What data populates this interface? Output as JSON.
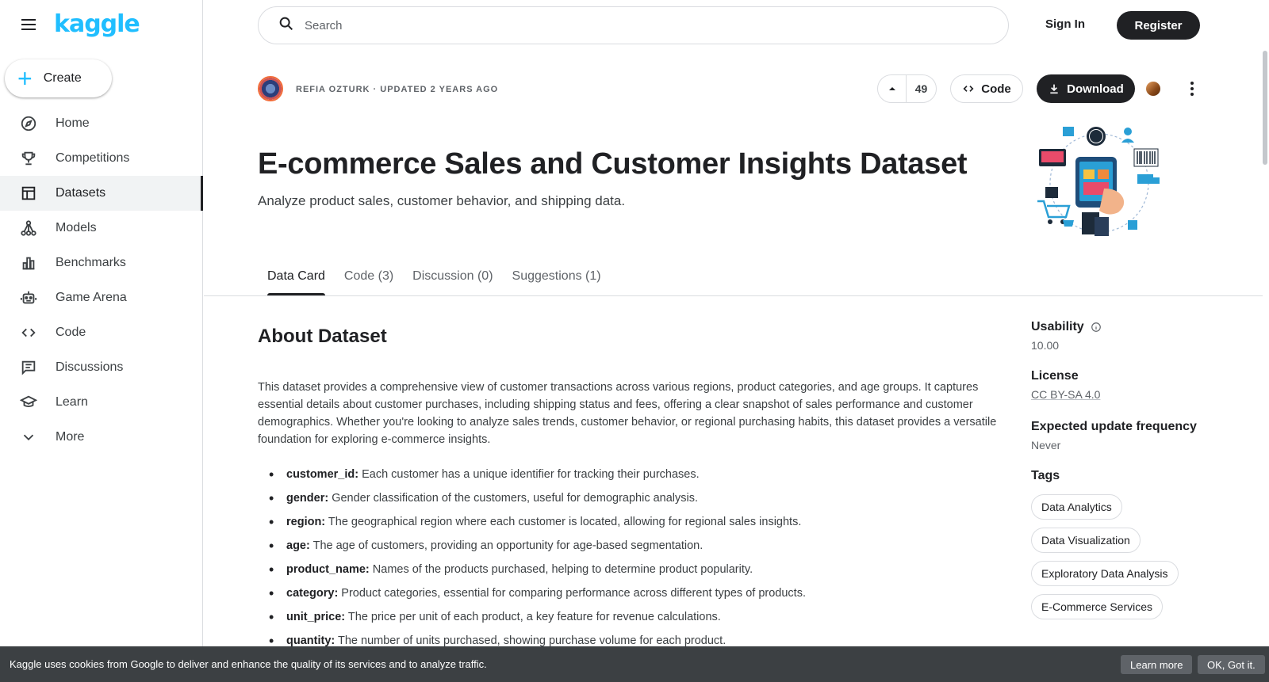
{
  "brand": {
    "logo_text": "kaggle"
  },
  "sidebar": {
    "create_label": "Create",
    "items": [
      {
        "label": "Home",
        "icon": "compass-icon"
      },
      {
        "label": "Competitions",
        "icon": "trophy-icon"
      },
      {
        "label": "Datasets",
        "icon": "table-icon",
        "active": true
      },
      {
        "label": "Models",
        "icon": "models-icon"
      },
      {
        "label": "Benchmarks",
        "icon": "bar-chart-icon"
      },
      {
        "label": "Game Arena",
        "icon": "robot-icon"
      },
      {
        "label": "Code",
        "icon": "code-icon"
      },
      {
        "label": "Discussions",
        "icon": "discussion-icon"
      },
      {
        "label": "Learn",
        "icon": "graduation-cap-icon"
      },
      {
        "label": "More",
        "icon": "chevron-down-icon"
      }
    ]
  },
  "topbar": {
    "search_placeholder": "Search",
    "sign_in_label": "Sign In",
    "register_label": "Register"
  },
  "dataset": {
    "author_line": "Refia Ozturk · Updated 2 years ago",
    "vote_count": "49",
    "code_label": "Code",
    "download_label": "Download",
    "title": "E-commerce Sales and Customer Insights Dataset",
    "subtitle": "Analyze product sales, customer behavior, and shipping data."
  },
  "tabs": [
    {
      "label": "Data Card",
      "active": true
    },
    {
      "label": "Code (3)"
    },
    {
      "label": "Discussion (0)"
    },
    {
      "label": "Suggestions (1)"
    }
  ],
  "about": {
    "heading": "About Dataset",
    "description": "This dataset provides a comprehensive view of customer transactions across various regions, product categories, and age groups. It captures essential details about customer purchases, including shipping status and fees, offering a clear snapshot of sales performance and customer demographics. Whether you're looking to analyze sales trends, customer behavior, or regional purchasing habits, this dataset provides a versatile foundation for exploring e-commerce insights.",
    "fields": [
      {
        "name": "customer_id:",
        "text": " Each customer has a unique identifier for tracking their purchases."
      },
      {
        "name": "gender:",
        "text": " Gender classification of the customers, useful for demographic analysis."
      },
      {
        "name": "region:",
        "text": " The geographical region where each customer is located, allowing for regional sales insights."
      },
      {
        "name": "age:",
        "text": " The age of customers, providing an opportunity for age-based segmentation."
      },
      {
        "name": "product_name:",
        "text": " Names of the products purchased, helping to determine product popularity."
      },
      {
        "name": "category:",
        "text": " Product categories, essential for comparing performance across different types of products."
      },
      {
        "name": "unit_price:",
        "text": " The price per unit of each product, a key feature for revenue calculations."
      },
      {
        "name": "quantity:",
        "text": " The number of units purchased, showing purchase volume for each product."
      }
    ]
  },
  "meta": {
    "usability_label": "Usability",
    "usability_value": "10.00",
    "license_label": "License",
    "license_value": "CC BY-SA 4.0",
    "update_label": "Expected update frequency",
    "update_value": "Never",
    "tags_label": "Tags",
    "tags": [
      "Data Analytics",
      "Data Visualization",
      "Exploratory Data Analysis",
      "E-Commerce Services"
    ]
  },
  "cookie": {
    "text": "Kaggle uses cookies from Google to deliver and enhance the quality of its services and to analyze traffic.",
    "learn_more_label": "Learn more",
    "ok_label": "OK, Got it."
  },
  "colors": {
    "brand": "#20beff",
    "primary_dark": "#202124",
    "cookie_bg": "#3c4043"
  }
}
